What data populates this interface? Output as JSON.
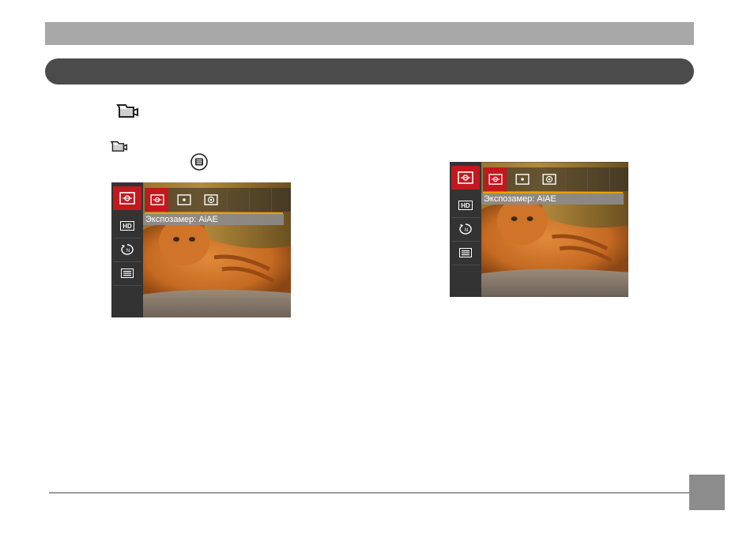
{
  "header": {
    "top_bar_color": "#a8a8a8",
    "section_bar_color": "#4b4b4b"
  },
  "icons": {
    "video_mode_1": "video-camera-icon",
    "video_mode_2": "video-camera-icon",
    "menu_button": "menu-button-icon"
  },
  "camera_screen": {
    "sidebar_items": [
      "exposure-metering-icon",
      "hd-resolution-icon",
      "continuous-af-icon",
      "menu-list-icon"
    ],
    "metering_options": [
      "ai-ae-metering-icon",
      "spot-metering-icon",
      "center-weighted-metering-icon"
    ],
    "selected_label": "Экспозамер: AiAE",
    "accent_color": "#c2181e",
    "highlight_line_color": "#e8a100"
  },
  "footer": {
    "page_box_color": "#8c8c8c"
  }
}
